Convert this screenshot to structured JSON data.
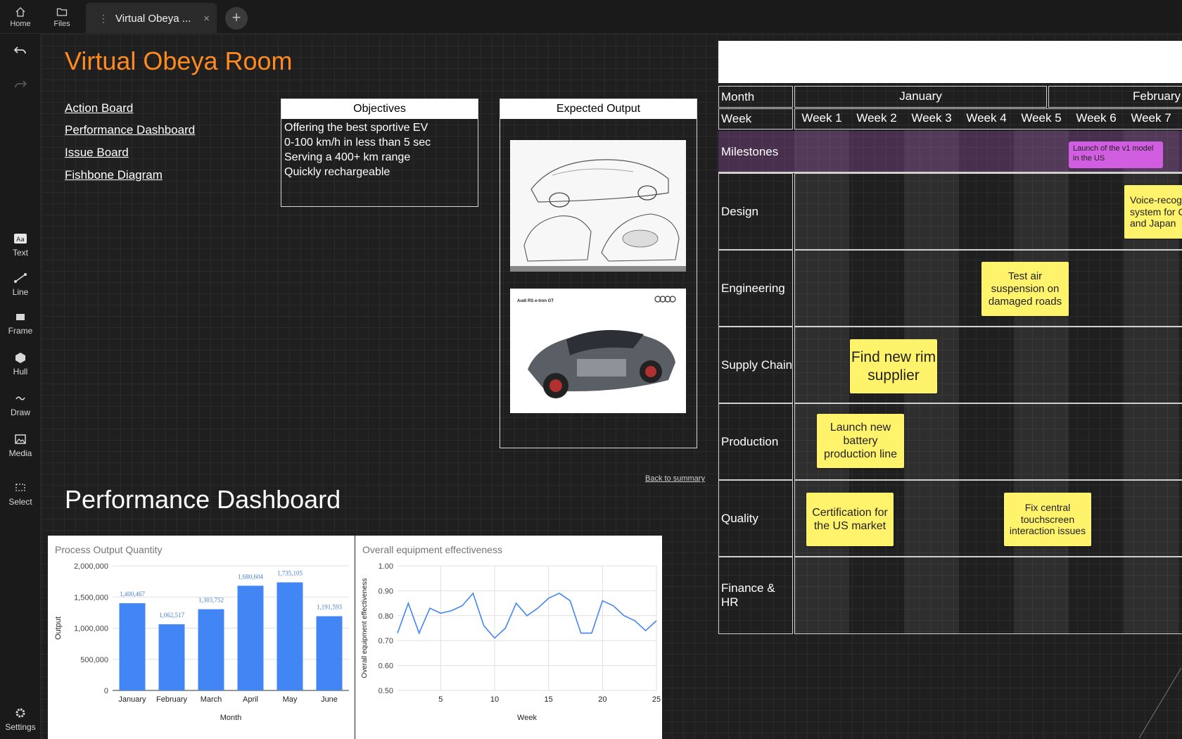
{
  "topbar": {
    "home_label": "Home",
    "files_label": "Files",
    "tab_label": "Virtual Obeya ...",
    "tab_close": "×",
    "add_tab": "+"
  },
  "sidebar": {
    "tools": [
      {
        "label": "Text",
        "icon": "text-icon"
      },
      {
        "label": "Line",
        "icon": "line-icon"
      },
      {
        "label": "Frame",
        "icon": "frame-icon"
      },
      {
        "label": "Hull",
        "icon": "hull-icon"
      },
      {
        "label": "Draw",
        "icon": "draw-icon"
      },
      {
        "label": "Media",
        "icon": "media-icon"
      },
      {
        "label": "Select",
        "icon": "select-icon"
      }
    ],
    "settings_label": "Settings"
  },
  "summary": {
    "title": "Virtual Obeya Room",
    "links": [
      "Action Board",
      "Performance Dashboard",
      "Issue Board",
      "Fishbone Diagram"
    ],
    "objectives": {
      "header": "Objectives",
      "lines": [
        "Offering the best sportive EV",
        "0-100 km/h in less than 5 sec",
        "Serving a 400+ km range",
        "Quickly rechargeable"
      ]
    },
    "expected_output": {
      "header": "Expected Output",
      "render_caption": "Audi RS e-tron GT"
    },
    "back_link": "Back to summary"
  },
  "dashboard": {
    "title": "Performance Dashboard"
  },
  "chart_data": [
    {
      "type": "bar",
      "title": "Process Output Quantity",
      "xlabel": "Month",
      "ylabel": "Output",
      "categories": [
        "January",
        "February",
        "March",
        "April",
        "May",
        "June"
      ],
      "values": [
        1400467,
        1062517,
        1303752,
        1680604,
        1735105,
        1191593
      ],
      "data_labels": [
        "1,400,467",
        "1,062,517",
        "1,303,752",
        "1,680,604",
        "1,735,105",
        "1,191,593"
      ],
      "ylim": [
        0,
        2000000
      ],
      "yticks": [
        "0",
        "500,000",
        "1,000,000",
        "1,500,000",
        "2,000,000"
      ],
      "color": "#4285f4",
      "grid": true
    },
    {
      "type": "line",
      "title": "Overall equipment effectiveness",
      "xlabel": "Week",
      "ylabel": "Overall equipment effectiveness",
      "x": [
        1,
        2,
        3,
        4,
        5,
        6,
        7,
        8,
        9,
        10,
        11,
        12,
        13,
        14,
        15,
        16,
        17,
        18,
        19,
        20,
        21,
        22,
        23,
        24,
        25
      ],
      "values": [
        0.73,
        0.85,
        0.73,
        0.83,
        0.81,
        0.82,
        0.84,
        0.89,
        0.76,
        0.71,
        0.75,
        0.85,
        0.8,
        0.83,
        0.87,
        0.89,
        0.86,
        0.73,
        0.73,
        0.86,
        0.84,
        0.8,
        0.78,
        0.74,
        0.78
      ],
      "xlim": [
        1,
        25
      ],
      "ylim": [
        0.5,
        1.0
      ],
      "xticks": [
        "5",
        "10",
        "15",
        "20",
        "25"
      ],
      "yticks": [
        "0.50",
        "0.60",
        "0.70",
        "0.80",
        "0.90",
        "1.00"
      ],
      "color": "#4285f4",
      "grid": true
    }
  ],
  "board": {
    "month_label": "Month",
    "week_label": "Week",
    "months": [
      "January",
      "February"
    ],
    "weeks": [
      "Week 1",
      "Week 2",
      "Week 3",
      "Week 4",
      "Week 5",
      "Week 6",
      "Week 7"
    ],
    "rows": [
      "Milestones",
      "Design",
      "Engineering",
      "Supply Chain",
      "Production",
      "Quality",
      "Finance & HR"
    ],
    "stickies": {
      "milestone": "Launch of the v1 model in the US",
      "design": "Voice-recognition system for China and Japan",
      "engineering": "Test air suspension on damaged roads",
      "supply": "Find new rim supplier",
      "production": "Launch new battery production line",
      "quality_cert": "Certification for the US market",
      "quality_fix": "Fix central touchscreen interaction issues"
    }
  }
}
